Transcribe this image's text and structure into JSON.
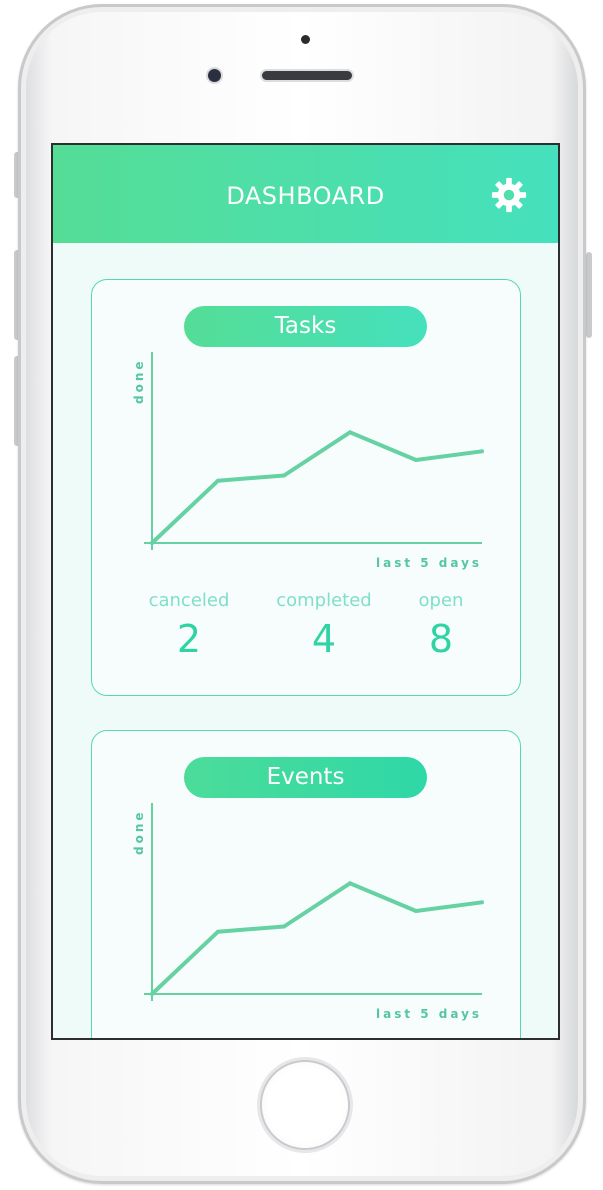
{
  "header": {
    "title": "DASHBOARD",
    "settings_icon": "gear-icon"
  },
  "colors": {
    "accent_start": "#55dd96",
    "accent_end": "#45e0bd",
    "line": "#66d2a4",
    "screen_bg": "#eefbf8"
  },
  "cards": {
    "tasks": {
      "title": "Tasks",
      "ylabel": "done",
      "xlabel": "last 5 days",
      "stats": [
        {
          "label": "canceled",
          "value": "2"
        },
        {
          "label": "completed",
          "value": "4"
        },
        {
          "label": "open",
          "value": "8"
        }
      ]
    },
    "events": {
      "title": "Events",
      "ylabel": "done",
      "xlabel": "last 5 days"
    }
  },
  "chart_data": [
    {
      "type": "line",
      "x": [
        0,
        1,
        2,
        3,
        4,
        5
      ],
      "values": [
        0,
        3.6,
        3.9,
        6.4,
        4.8,
        5.3
      ],
      "ylim": [
        0,
        10
      ],
      "xlabel": "last 5 days",
      "ylabel": "done",
      "grid": false
    },
    {
      "type": "line",
      "x": [
        0,
        1,
        2,
        3,
        4,
        5
      ],
      "values": [
        0,
        3.6,
        3.9,
        6.4,
        4.8,
        5.3
      ],
      "ylim": [
        0,
        10
      ],
      "xlabel": "last 5 days",
      "ylabel": "done",
      "grid": false
    }
  ]
}
